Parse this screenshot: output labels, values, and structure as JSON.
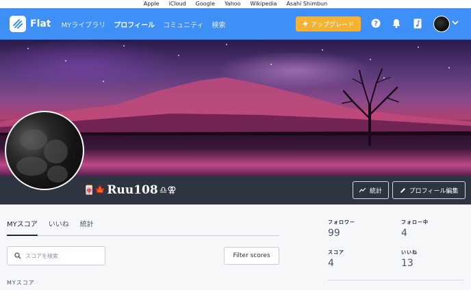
{
  "bookmarks": [
    "Apple",
    "iCloud",
    "Google",
    "Yahoo",
    "Wikipedia",
    "Asahi Shimbun"
  ],
  "nav": {
    "brand": "Flat",
    "links": [
      "MYライブラリ",
      "プロフィール",
      "コミュニティ",
      "検索"
    ],
    "active_link": "プロフィール",
    "upgrade_label": "アップグレード",
    "accent_color": "#3e8ff6",
    "upgrade_color": "#f5b335"
  },
  "profile": {
    "username_prefix": "🀄🍁",
    "username": "Ruu108",
    "username_suffix": "♎︎⚢",
    "stats_button": "統計",
    "edit_button": "プロフィール編集"
  },
  "tabs": [
    "MYスコア",
    "いいね",
    "統計"
  ],
  "active_tab": "MYスコア",
  "search": {
    "placeholder": "スコアを検索"
  },
  "filter_button": "Filter scores",
  "section_label": "MYスコア",
  "stats": {
    "followers_label": "フォロワー",
    "followers_value": "99",
    "following_label": "フォロー中",
    "following_value": "4",
    "scores_label": "スコア",
    "scores_value": "4",
    "likes_label": "いいね",
    "likes_value": "13"
  }
}
